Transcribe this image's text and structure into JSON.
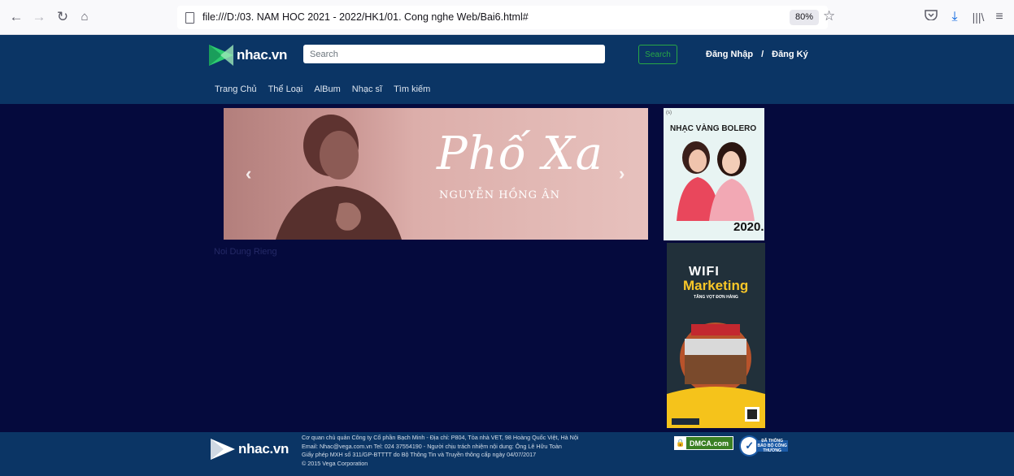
{
  "browser": {
    "url": "file:///D:/03. NAM HOC 2021 - 2022/HK1/01. Cong nghe Web/Bai6.html#",
    "zoom": "80%"
  },
  "header": {
    "logo_text": "nhac.vn",
    "search_placeholder": "Search",
    "search_button": "Search",
    "login": "Đăng Nhập",
    "separator": "/",
    "register": "Đăng Ký"
  },
  "menu": [
    "Trang Chủ",
    "Thể Loại",
    "AlBum",
    "Nhạc sĩ",
    "Tìm kiếm"
  ],
  "banner": {
    "title": "Phố Xa",
    "subtitle": "NGUYỄN HỒNG ÂN",
    "prev": "‹",
    "next": "›"
  },
  "content_label": "Noi Dung Rieng",
  "ads": {
    "bolero": {
      "tag": "(s)",
      "title": "NHẠC VÀNG BOLERO",
      "year": "2020."
    },
    "wifi": {
      "title": "WIFI",
      "subtitle": "Marketing",
      "tagline": "TĂNG VỌT ĐƠN HÀNG"
    }
  },
  "footer": {
    "logo_text": "nhac.vn",
    "lines": [
      "Cơ quan chủ quản Công ty Cổ phần Bạch Minh - Địa chỉ: P804, Tòa nhà VET, 98 Hoàng Quốc Việt, Hà Nội",
      "Email: Nhac@vega.com.vn Tel: 024 37554190 - Người chịu trách nhiệm nội dung: Ông Lê Hữu Toàn",
      "Giấy phép MXH số 311/GP-BTTTT do Bộ Thông Tin và Truyền thông cấp ngày 04/07/2017",
      "© 2015 Vega Corporation"
    ],
    "dmca": "DMCA.com",
    "bct": "ĐÃ THÔNG BÁO BỘ CÔNG THƯƠNG"
  },
  "colors": {
    "header_bg": "#0b3565",
    "main_bg": "#050a3d",
    "accent_green": "#28a745"
  }
}
